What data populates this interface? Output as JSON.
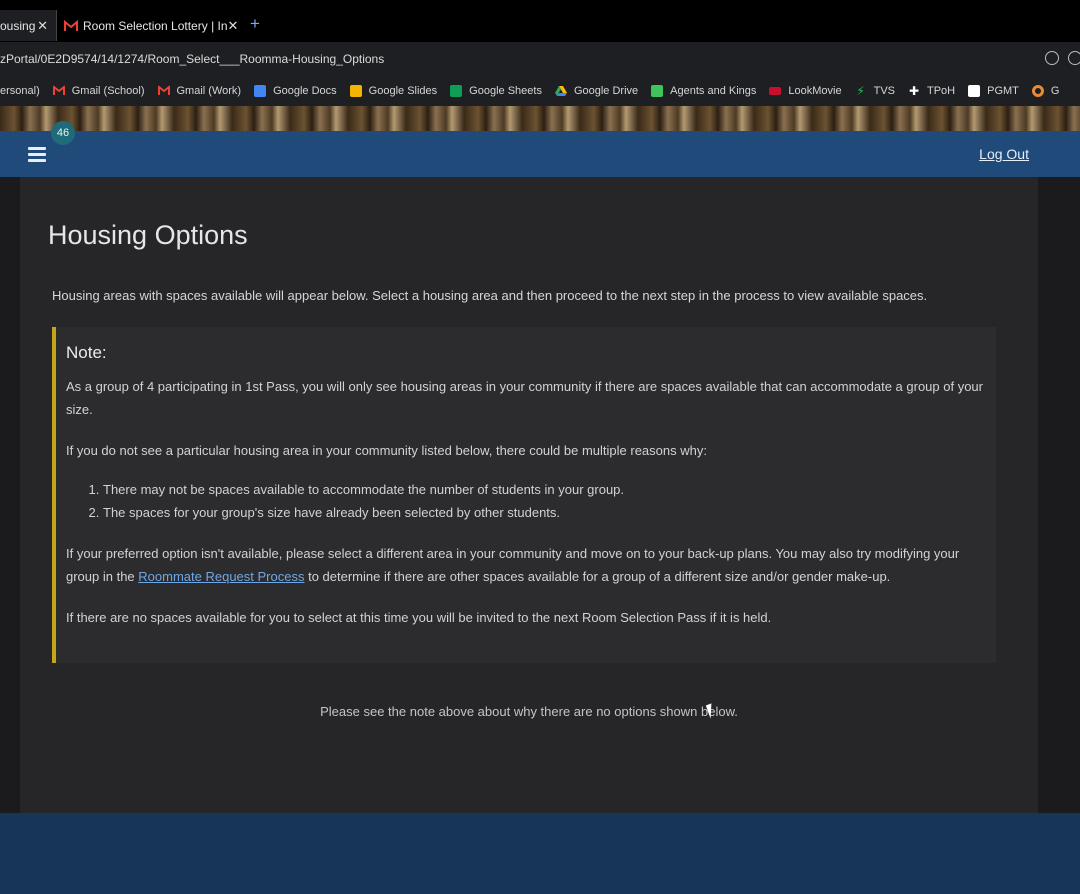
{
  "browser": {
    "tabs": [
      {
        "label": "ousing",
        "close": "✕"
      },
      {
        "label": "Room Selection Lottery | In",
        "close": "✕"
      }
    ],
    "new_tab": "+",
    "url": "zPortal/0E2D9574/14/1274/Room_Select___Roomma-Housing_Options",
    "bookmarks": [
      {
        "label": "ersonal)",
        "color": "#c9c9c9"
      },
      {
        "label": "Gmail (School)",
        "color": "#ea4335"
      },
      {
        "label": "Gmail (Work)",
        "color": "#ea4335"
      },
      {
        "label": "Google Docs",
        "color": "#4285f4"
      },
      {
        "label": "Google Slides",
        "color": "#f4b400"
      },
      {
        "label": "Google Sheets",
        "color": "#0f9d58"
      },
      {
        "label": "Google Drive",
        "color": "#34a853"
      },
      {
        "label": "Agents and Kings",
        "color": "#3ec45a"
      },
      {
        "label": "LookMovie",
        "color": "#c8102e"
      },
      {
        "label": "TVS",
        "color": "#22c55e"
      },
      {
        "label": "TPoH",
        "color": "#ffffff"
      },
      {
        "label": "PGMT",
        "color": "#ffffff"
      },
      {
        "label": "G",
        "color": "#ea8a35"
      }
    ]
  },
  "header": {
    "badge": "46",
    "logout": "Log Out"
  },
  "main": {
    "title": "Housing Options",
    "intro": "Housing areas with spaces available will appear below. Select a housing area and then proceed to the next step in the process to view available spaces.",
    "note": {
      "heading": "Note:",
      "p1": "As a group of 4 participating in 1st Pass, you will only see housing areas in your community if there are spaces available that can accommodate a group of your size.",
      "p2": "If you do not see a particular housing area in your community listed below, there could be multiple reasons why:",
      "reasons": [
        "There may not be spaces available to accommodate the number of students in your group.",
        "The spaces for your group's size have already been selected by other students."
      ],
      "p3_before": "If your preferred option isn't available, please select a different area in your community and move on to your back-up plans. You may also try modifying your group in the ",
      "p3_link": "Roommate Request Process",
      "p3_after": " to determine if there are other spaces available for a group of a different size and/or gender make-up.",
      "p4": "If there are no spaces available for you to select at this time you will be invited to the next Room Selection Pass if it is held."
    },
    "no_options": "Please see the note above about why there are no options shown below."
  },
  "colors": {
    "nav": "#1f4a7a",
    "note_border": "#c7a51a",
    "footer": "#173559"
  }
}
